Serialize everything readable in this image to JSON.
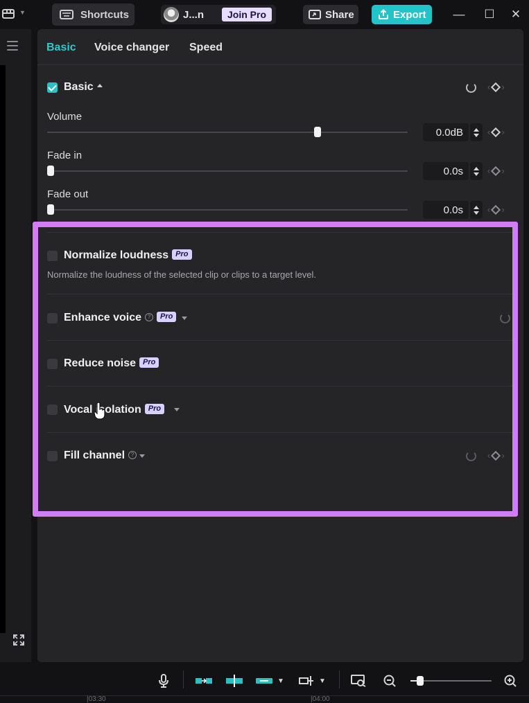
{
  "topbar": {
    "shortcuts_label": "Shortcuts",
    "user_name": "J...n",
    "join_pro_label": "Join Pro",
    "share_label": "Share",
    "export_label": "Export",
    "minimize": "—",
    "maximize": "☐",
    "close": "✕",
    "accent_color": "#22c4c9"
  },
  "tabs": [
    {
      "label": "Basic",
      "active": true
    },
    {
      "label": "Voice changer",
      "active": false
    },
    {
      "label": "Speed",
      "active": false
    }
  ],
  "basic": {
    "title": "Basic",
    "checked": true,
    "volume": {
      "label": "Volume",
      "value": "0.0dB",
      "level": 0.75
    },
    "fade_in": {
      "label": "Fade in",
      "value": "0.0s",
      "level": 0
    },
    "fade_out": {
      "label": "Fade out",
      "value": "0.0s",
      "level": 0
    }
  },
  "sections": {
    "normalize": {
      "title": "Normalize loudness",
      "badge": "Pro",
      "description": "Normalize the loudness of the selected clip or clips to a target level."
    },
    "enhance": {
      "title": "Enhance voice",
      "badge": "Pro"
    },
    "reduce": {
      "title": "Reduce noise",
      "badge": "Pro"
    },
    "vocal": {
      "title": "Vocal isolation",
      "badge": "Pro"
    },
    "fill": {
      "title": "Fill channel"
    }
  },
  "timeline": {
    "ruler_labels": [
      "|03:30",
      "|04:00"
    ],
    "zoom_level": 0.12
  },
  "highlight_color": "#d27cf5"
}
